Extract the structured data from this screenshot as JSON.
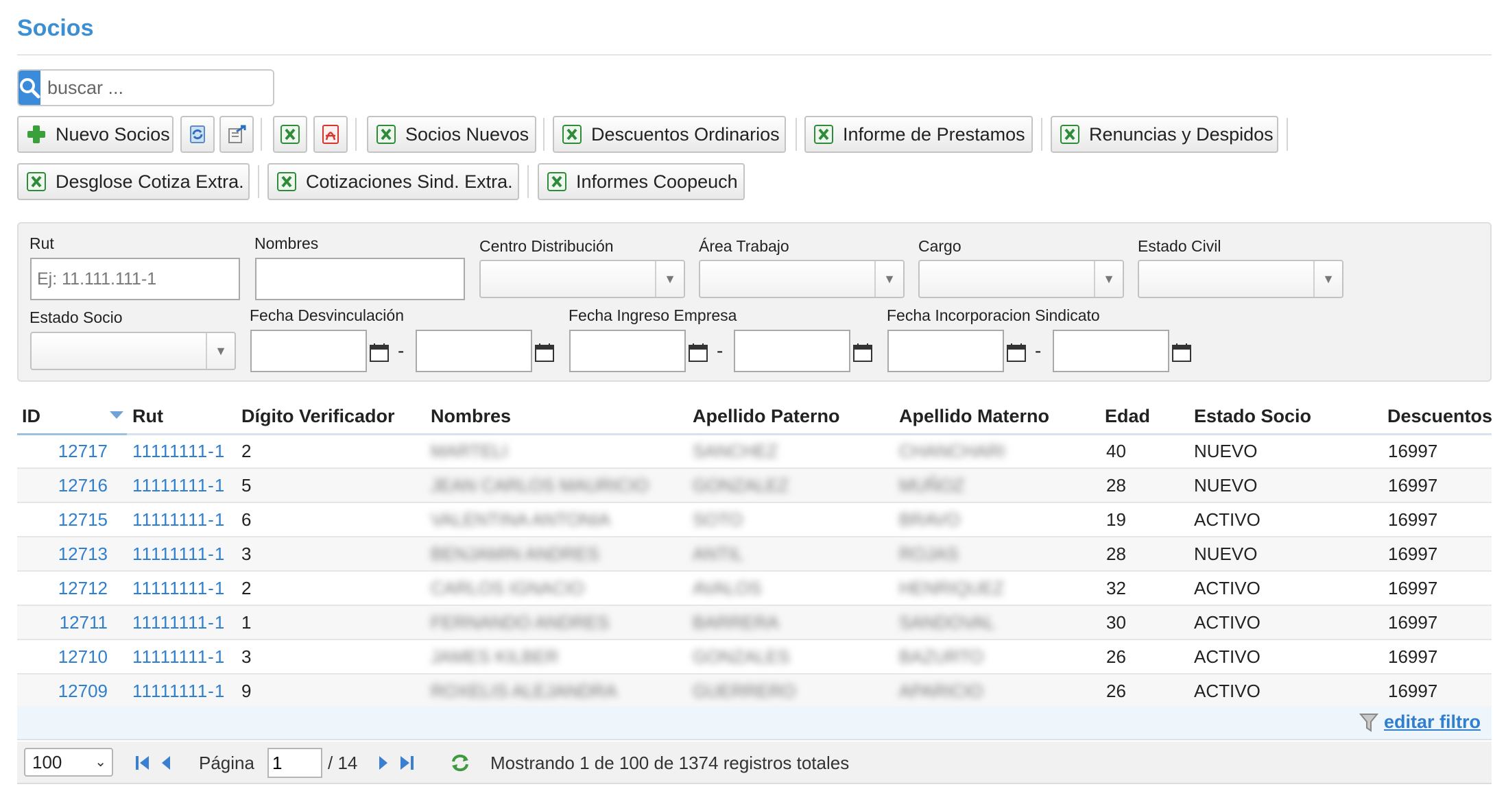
{
  "page": {
    "title": "Socios"
  },
  "search": {
    "placeholder": "buscar ..."
  },
  "toolbar": {
    "new_label": "Nuevo Socios",
    "socios_nuevos": "Socios Nuevos",
    "descuentos_ordinarios": "Descuentos Ordinarios",
    "informe_prestamos": "Informe de Prestamos",
    "renuncias_despidos": "Renuncias y Despidos",
    "desglose_cotiza": "Desglose Cotiza Extra.",
    "cotizaciones_sind": "Cotizaciones Sind. Extra.",
    "informes_coopeuch": "Informes Coopeuch"
  },
  "filters": {
    "rut_label": "Rut",
    "rut_placeholder": "Ej: 11.111.111-1",
    "nombres_label": "Nombres",
    "centro_label": "Centro Distribución",
    "area_label": "Área Trabajo",
    "cargo_label": "Cargo",
    "estado_civil_label": "Estado Civil",
    "estado_socio_label": "Estado Socio",
    "fecha_desv_label": "Fecha Desvinculación",
    "fecha_ingreso_label": "Fecha Ingreso Empresa",
    "fecha_incorp_label": "Fecha Incorporacion Sindicato",
    "range_separator": "-"
  },
  "table": {
    "columns": [
      "ID",
      "Rut",
      "Dígito Verificador",
      "Nombres",
      "Apellido Paterno",
      "Apellido Materno",
      "Edad",
      "Estado Socio",
      "Descuentos"
    ],
    "rows": [
      {
        "id": "12717",
        "rut": "11111111-1",
        "dv": "2",
        "nombres": "MARTELI",
        "paterno": "SANCHEZ",
        "materno": "CHANCHARI",
        "edad": "40",
        "estado": "NUEVO",
        "descuentos": "16997"
      },
      {
        "id": "12716",
        "rut": "11111111-1",
        "dv": "5",
        "nombres": "JEAN CARLOS MAURICIO",
        "paterno": "GONZALEZ",
        "materno": "MUÑOZ",
        "edad": "28",
        "estado": "NUEVO",
        "descuentos": "16997"
      },
      {
        "id": "12715",
        "rut": "11111111-1",
        "dv": "6",
        "nombres": "VALENTINA ANTONIA",
        "paterno": "SOTO",
        "materno": "BRAVO",
        "edad": "19",
        "estado": "ACTIVO",
        "descuentos": "16997"
      },
      {
        "id": "12713",
        "rut": "11111111-1",
        "dv": "3",
        "nombres": "BENJAMIN ANDRES",
        "paterno": "ANTIL",
        "materno": "ROJAS",
        "edad": "28",
        "estado": "NUEVO",
        "descuentos": "16997"
      },
      {
        "id": "12712",
        "rut": "11111111-1",
        "dv": "2",
        "nombres": "CARLOS IGNACIO",
        "paterno": "AVALOS",
        "materno": "HENRIQUEZ",
        "edad": "32",
        "estado": "ACTIVO",
        "descuentos": "16997"
      },
      {
        "id": "12711",
        "rut": "11111111-1",
        "dv": "1",
        "nombres": "FERNANDO ANDRES",
        "paterno": "BARRERA",
        "materno": "SANDOVAL",
        "edad": "30",
        "estado": "ACTIVO",
        "descuentos": "16997"
      },
      {
        "id": "12710",
        "rut": "11111111-1",
        "dv": "3",
        "nombres": "JAMES KILBER",
        "paterno": "GONZALES",
        "materno": "BAZURTO",
        "edad": "26",
        "estado": "ACTIVO",
        "descuentos": "16997"
      },
      {
        "id": "12709",
        "rut": "11111111-1",
        "dv": "9",
        "nombres": "ROXELIS ALEJANDRA",
        "paterno": "GUERRERO",
        "materno": "APARICIO",
        "edad": "26",
        "estado": "ACTIVO",
        "descuentos": "16997"
      }
    ],
    "edit_filter_label": "editar filtro"
  },
  "pager": {
    "page_size": "100",
    "page_label": "Página",
    "current_page": "1",
    "total_pages": "/ 14",
    "summary": "Mostrando 1 de 100 de 1374 registros totales"
  },
  "colors": {
    "accent": "#3a8bd9",
    "link": "#2f7fce",
    "excel_green": "#2e8b3a",
    "pdf_red": "#d9342b"
  },
  "icons": [
    "search-icon",
    "plus-icon",
    "refresh-icon",
    "export-icon",
    "excel-icon",
    "pdf-icon",
    "calendar-icon",
    "filter-icon",
    "first-page-icon",
    "prev-page-icon",
    "next-page-icon",
    "last-page-icon",
    "reload-icon"
  ]
}
